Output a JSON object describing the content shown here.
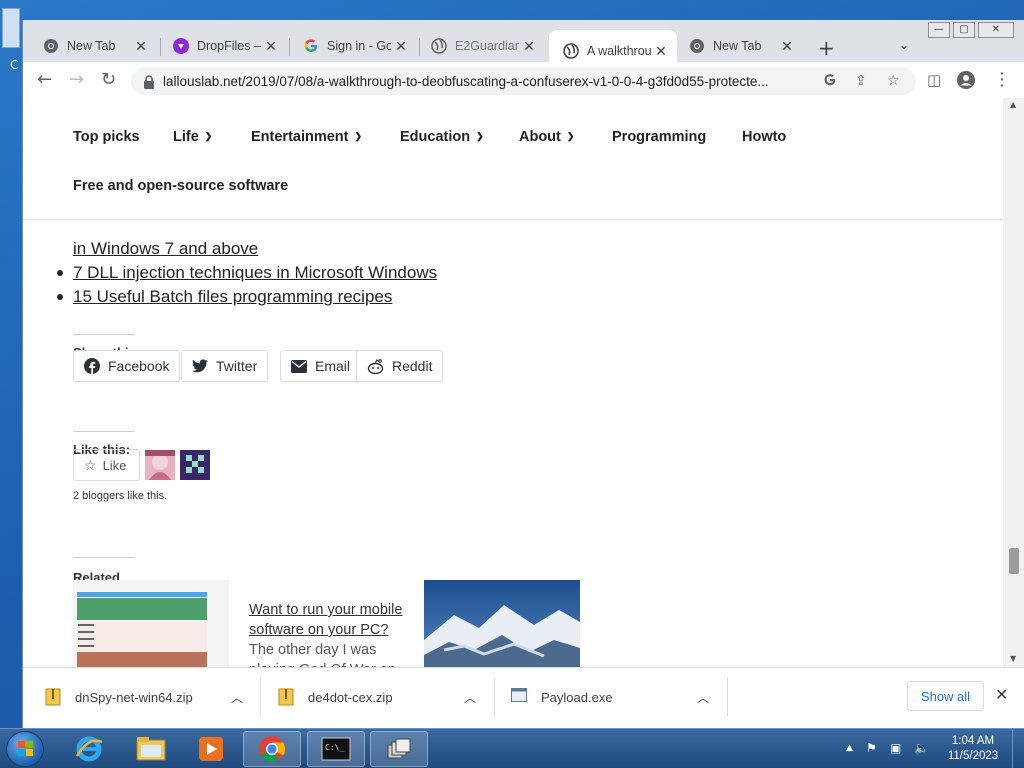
{
  "browser": {
    "tabs": [
      {
        "title": "New Tab",
        "icon": "chrome-icon"
      },
      {
        "title": "DropFiles —",
        "icon": "dropfiles-icon"
      },
      {
        "title": "Sign in - Go",
        "icon": "google-icon"
      },
      {
        "title": "E2Guardian",
        "icon": "globe-icon"
      },
      {
        "title": "A walkthrou",
        "icon": "globe-icon",
        "active": true
      },
      {
        "title": "New Tab",
        "icon": "chrome-icon"
      }
    ],
    "url": "lallouslab.net/2019/07/08/a-walkthrough-to-deobfuscating-a-confuserex-v1-0-0-4-g3fd0d55-protecte..."
  },
  "site_nav": {
    "items": [
      {
        "label": "Top picks",
        "dropdown": false
      },
      {
        "label": "Life",
        "dropdown": true
      },
      {
        "label": "Entertainment",
        "dropdown": true
      },
      {
        "label": "Education",
        "dropdown": true
      },
      {
        "label": "About",
        "dropdown": true
      },
      {
        "label": "Programming",
        "dropdown": false
      },
      {
        "label": "Howto",
        "dropdown": false
      },
      {
        "label": "Free and open-source software",
        "dropdown": false
      }
    ]
  },
  "article": {
    "related_posts": [
      "in Windows 7 and above",
      "7 DLL injection techniques in Microsoft Windows",
      "15 Useful Batch files programming recipes"
    ],
    "share_heading": "Share this:",
    "share_buttons": [
      "Facebook",
      "Twitter",
      "Email",
      "Reddit"
    ],
    "like_heading": "Like this:",
    "like_label": "Like",
    "bloggers_text": "2 bloggers like this.",
    "related_heading": "Related",
    "related_item": {
      "title": "Want to run your mobile software on your PC?",
      "excerpt": "The other day I was playing God Of War on"
    }
  },
  "downloads": {
    "items": [
      {
        "name": "dnSpy-net-win64.zip",
        "icon": "zip-file-icon"
      },
      {
        "name": "de4dot-cex.zip",
        "icon": "zip-file-icon"
      },
      {
        "name": "Payload.exe",
        "icon": "exe-file-icon"
      }
    ],
    "show_all": "Show all"
  },
  "taskbar": {
    "time": "1:04 AM",
    "date": "11/5/2023"
  },
  "colors": {
    "accent_blue": "#1a73e8",
    "tab_strip": "#dee1e6",
    "taskbar": "#1f4a7e"
  }
}
